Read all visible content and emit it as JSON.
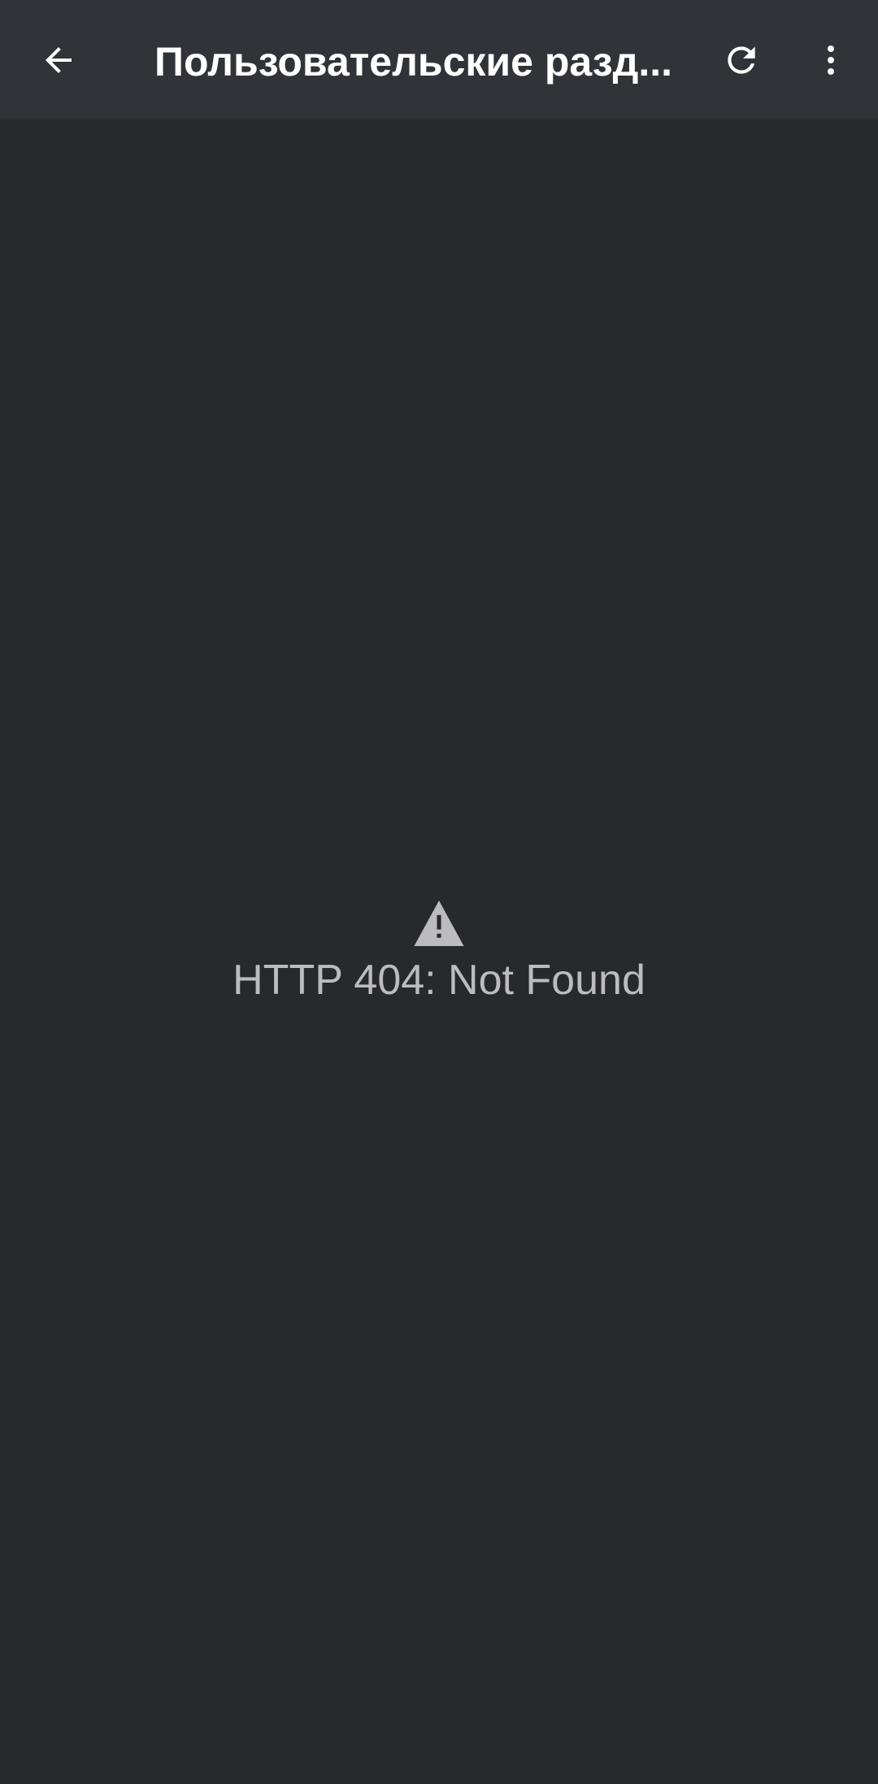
{
  "app_bar": {
    "title": "Пользовательские разд...",
    "back_icon": "arrow-left-icon",
    "refresh_icon": "refresh-icon",
    "more_icon": "more-vert-icon"
  },
  "error": {
    "icon": "warning-icon",
    "message": "HTTP 404: Not Found"
  },
  "colors": {
    "background": "#28292d",
    "app_bar": "#323338",
    "title_text": "#ffffff",
    "error_text": "#bcbcbf",
    "icon_color": "#ffffff",
    "warning_icon_color": "#bcbcbf"
  }
}
